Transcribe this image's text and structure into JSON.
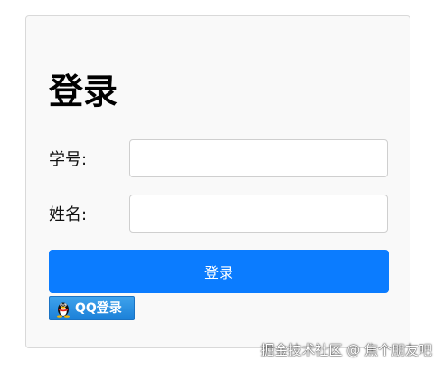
{
  "form": {
    "title": "登录",
    "student_id_label": "学号:",
    "student_id_value": "",
    "name_label": "姓名:",
    "name_value": "",
    "login_button_label": "登录"
  },
  "qq_login": {
    "icon": "qq-penguin-icon",
    "label": "QQ登录"
  },
  "watermark": {
    "text": "掘金技术社区 @ 焦个朋友吧"
  },
  "colors": {
    "primary": "#0b7cff",
    "card_background": "#f9f9f9",
    "qq_button": "#2a8fe0"
  }
}
